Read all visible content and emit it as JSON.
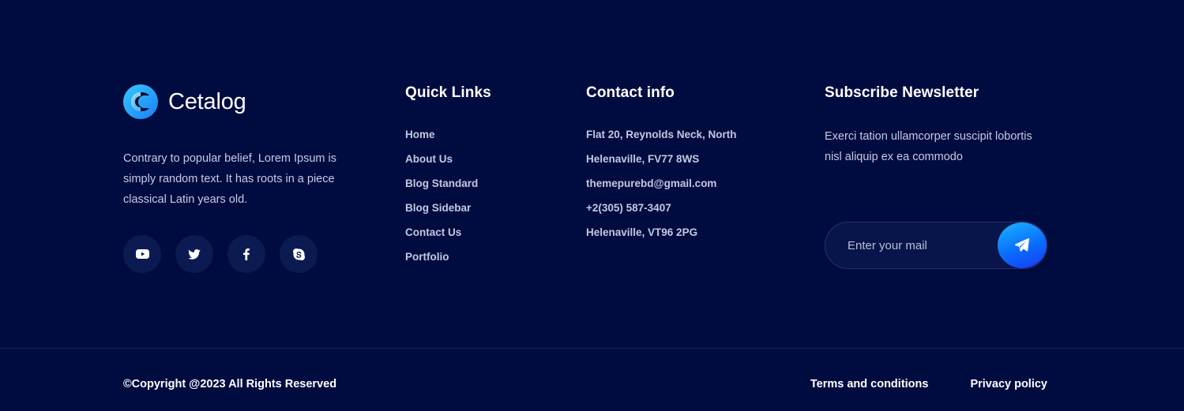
{
  "brand": {
    "name": "Cetalog",
    "description": "Contrary to popular belief, Lorem Ipsum is simply random text. It has roots in a piece classical Latin years old."
  },
  "socials": [
    {
      "icon": "youtube-icon"
    },
    {
      "icon": "twitter-icon"
    },
    {
      "icon": "facebook-icon"
    },
    {
      "icon": "skype-icon"
    }
  ],
  "quick_links": {
    "title": "Quick Links",
    "items": [
      "Home",
      "About Us",
      "Blog Standard",
      "Blog Sidebar",
      "Contact Us",
      "Portfolio"
    ]
  },
  "contact": {
    "title": "Contact info",
    "items": [
      "Flat 20, Reynolds Neck, North",
      "Helenaville, FV77 8WS",
      "themepurebd@gmail.com",
      "+2(305) 587-3407",
      "Helenaville, VT96 2PG"
    ]
  },
  "newsletter": {
    "title": "Subscribe Newsletter",
    "text": "Exerci tation ullamcorper suscipit lobortis nisl aliquip ex ea commodo",
    "placeholder": "Enter your mail",
    "send_icon": "paper-plane-icon"
  },
  "bottom": {
    "copyright": "©Copyright @2023 All Rights Reserved",
    "terms": "Terms and conditions",
    "privacy": "Privacy policy"
  },
  "colors": {
    "background": "#000c40",
    "accent_start": "#1bb5ff",
    "accent_end": "#1a38f0",
    "social_bg": "#0c1a52"
  }
}
